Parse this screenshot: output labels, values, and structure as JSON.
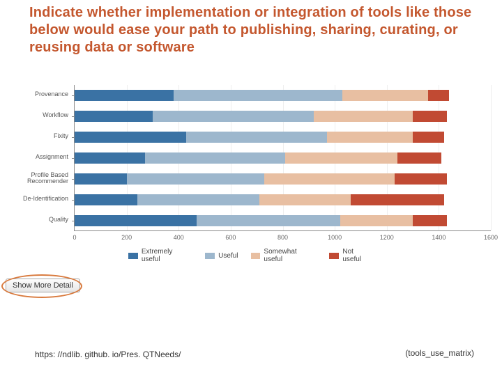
{
  "title": "Indicate whether implementation or integration of tools like those below would ease your path to publishing, sharing, curating, or reusing data or software",
  "footer_url": "https: //ndlib. github. io/Pres. QTNeeds/",
  "footer_tag": "(tools_use_matrix)",
  "show_more_label": "Show More Detail",
  "chart_data": {
    "type": "bar",
    "orientation": "horizontal-stacked",
    "xlabel": "",
    "ylabel": "",
    "xlim": [
      0,
      1600
    ],
    "x_ticks": [
      0,
      200,
      400,
      600,
      800,
      1000,
      1200,
      1400,
      1600
    ],
    "categories": [
      "Provenance",
      "Workflow",
      "Fixity",
      "Assignment",
      "Profile Based Recommender",
      "De-Identification",
      "Quality"
    ],
    "series": [
      {
        "name": "Extremely useful",
        "color": "#3a72a4",
        "values": [
          380,
          300,
          430,
          270,
          200,
          240,
          470
        ]
      },
      {
        "name": "Useful",
        "color": "#9db7cd",
        "values": [
          650,
          620,
          540,
          540,
          530,
          470,
          550
        ]
      },
      {
        "name": "Somewhat useful",
        "color": "#e8bfa2",
        "values": [
          330,
          380,
          330,
          430,
          500,
          350,
          280
        ]
      },
      {
        "name": "Not useful",
        "color": "#c14a33",
        "values": [
          80,
          130,
          120,
          170,
          200,
          360,
          130
        ]
      }
    ]
  }
}
